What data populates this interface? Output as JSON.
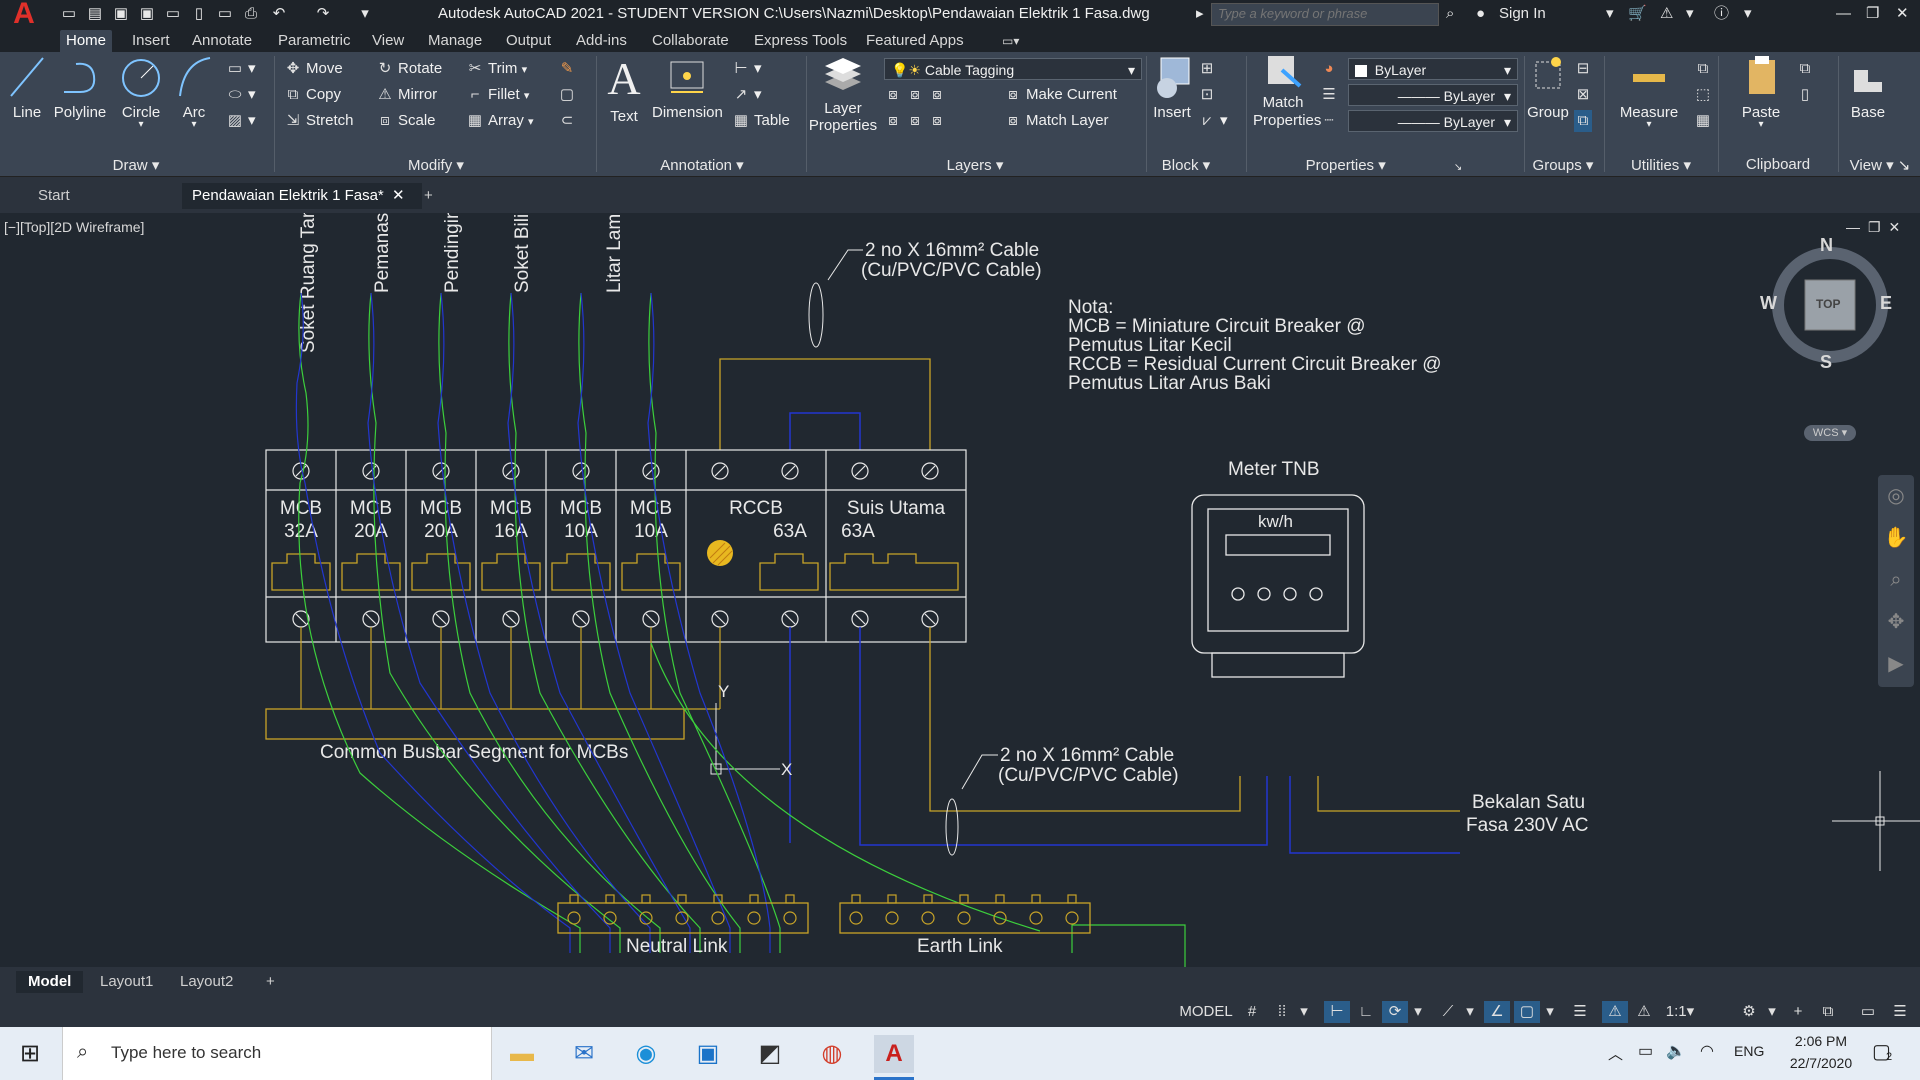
{
  "title_bar": {
    "app_logo": "A",
    "title": "Autodesk AutoCAD 2021 - STUDENT VERSION    C:\\Users\\Nazmi\\Desktop\\Pendawaian Elektrik 1 Fasa.dwg",
    "search_placeholder": "Type a keyword or phrase",
    "sign_in": "Sign In"
  },
  "ribbon_tabs": [
    "Home",
    "Insert",
    "Annotate",
    "Parametric",
    "View",
    "Manage",
    "Output",
    "Add-ins",
    "Collaborate",
    "Express Tools",
    "Featured Apps"
  ],
  "ribbon": {
    "draw": {
      "title": "Draw",
      "line": "Line",
      "polyline": "Polyline",
      "circle": "Circle",
      "arc": "Arc"
    },
    "modify": {
      "title": "Modify",
      "move": "Move",
      "rotate": "Rotate",
      "trim": "Trim",
      "copy": "Copy",
      "mirror": "Mirror",
      "fillet": "Fillet",
      "stretch": "Stretch",
      "scale": "Scale",
      "array": "Array"
    },
    "annotation": {
      "title": "Annotation",
      "text": "Text",
      "dimension": "Dimension",
      "table": "Table"
    },
    "layers": {
      "title": "Layers",
      "layer_properties": "Layer Properties",
      "current_layer": "Cable Tagging",
      "make_current": "Make Current",
      "match_layer": "Match Layer"
    },
    "block": {
      "title": "Block",
      "insert": "Insert"
    },
    "properties": {
      "title": "Properties",
      "match_properties": "Match Properties",
      "color": "ByLayer",
      "linetype": "ByLayer",
      "lineweight": "ByLayer"
    },
    "groups": {
      "title": "Groups",
      "group": "Group"
    },
    "utilities": {
      "title": "Utilities",
      "measure": "Measure"
    },
    "clipboard": {
      "title": "Clipboard",
      "paste": "Paste"
    },
    "view": {
      "title": "View",
      "base": "Base"
    }
  },
  "file_tabs": {
    "start": "Start",
    "current": "Pendawaian Elektrik 1 Fasa*"
  },
  "viewport_label": "[−][Top][2D Wireframe]",
  "viewcube": {
    "n": "N",
    "s": "S",
    "e": "E",
    "w": "W",
    "top": "TOP",
    "wcs": "WCS"
  },
  "drawing": {
    "circuits": [
      "Soket Ruang Tamu",
      "Pemanas Air",
      "Pendingin Hawa",
      "Soket Bilik",
      "Litar Lampu & Kipas"
    ],
    "cable_note_top": [
      "2 no X 16mm² Cable",
      "(Cu/PVC/PVC Cable)"
    ],
    "cable_note_bottom": [
      "2 no X 16mm² Cable",
      "(Cu/PVC/PVC Cable)"
    ],
    "nota": [
      "Nota:",
      "MCB = Miniature Circuit Breaker @",
      "Pemutus Litar Kecil",
      "RCCB = Residual Current Circuit Breaker @",
      "Pemutus Litar Arus Baki"
    ],
    "breakers": [
      {
        "name": "MCB",
        "rating": "32A"
      },
      {
        "name": "MCB",
        "rating": "20A"
      },
      {
        "name": "MCB",
        "rating": "20A"
      },
      {
        "name": "MCB",
        "rating": "16A"
      },
      {
        "name": "MCB",
        "rating": "10A"
      },
      {
        "name": "MCB",
        "rating": "10A"
      }
    ],
    "rccb": {
      "name": "RCCB",
      "rating": "63A"
    },
    "main_switch": {
      "name": "Suis Utama",
      "rating": "63A"
    },
    "busbar": "Common Busbar Segment for MCBs",
    "meter_title": "Meter TNB",
    "meter_unit": "kw/h",
    "supply": [
      "Bekalan Satu",
      "Fasa 230V AC"
    ],
    "neutral_link": "Neutral Link",
    "earth_link": "Earth Link",
    "ucs_x": "X",
    "ucs_y": "Y",
    "colors": {
      "yellow": "#c8a428",
      "green": "#3ccf3c",
      "blue": "#2236d0",
      "white": "#e8e8e8"
    }
  },
  "layout_tabs": [
    "Model",
    "Layout1",
    "Layout2"
  ],
  "status": {
    "model": "MODEL",
    "scale": "1:1"
  },
  "taskbar": {
    "search_placeholder": "Type here to search",
    "lang": "ENG",
    "time": "2:06 PM",
    "date": "22/7/2020",
    "notifications": "2"
  }
}
